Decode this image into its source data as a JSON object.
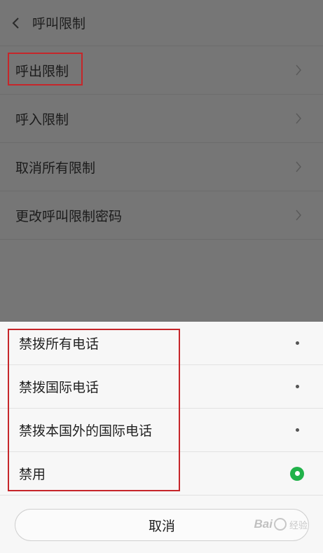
{
  "header": {
    "title": "呼叫限制"
  },
  "menu": {
    "items": [
      {
        "label": "呼出限制"
      },
      {
        "label": "呼入限制"
      },
      {
        "label": "取消所有限制"
      },
      {
        "label": "更改呼叫限制密码"
      }
    ]
  },
  "sheet": {
    "options": [
      {
        "label": "禁拨所有电话",
        "selected": false
      },
      {
        "label": "禁拨国际电话",
        "selected": false
      },
      {
        "label": "禁拨本国外的国际电话",
        "selected": false
      },
      {
        "label": "禁用",
        "selected": true
      }
    ],
    "cancel_label": "取消"
  },
  "watermark": {
    "logo": "Bai",
    "text": "经验"
  },
  "colors": {
    "accent_green": "#21b24a",
    "highlight_red": "#c6262a",
    "dim_overlay": "#767676"
  }
}
